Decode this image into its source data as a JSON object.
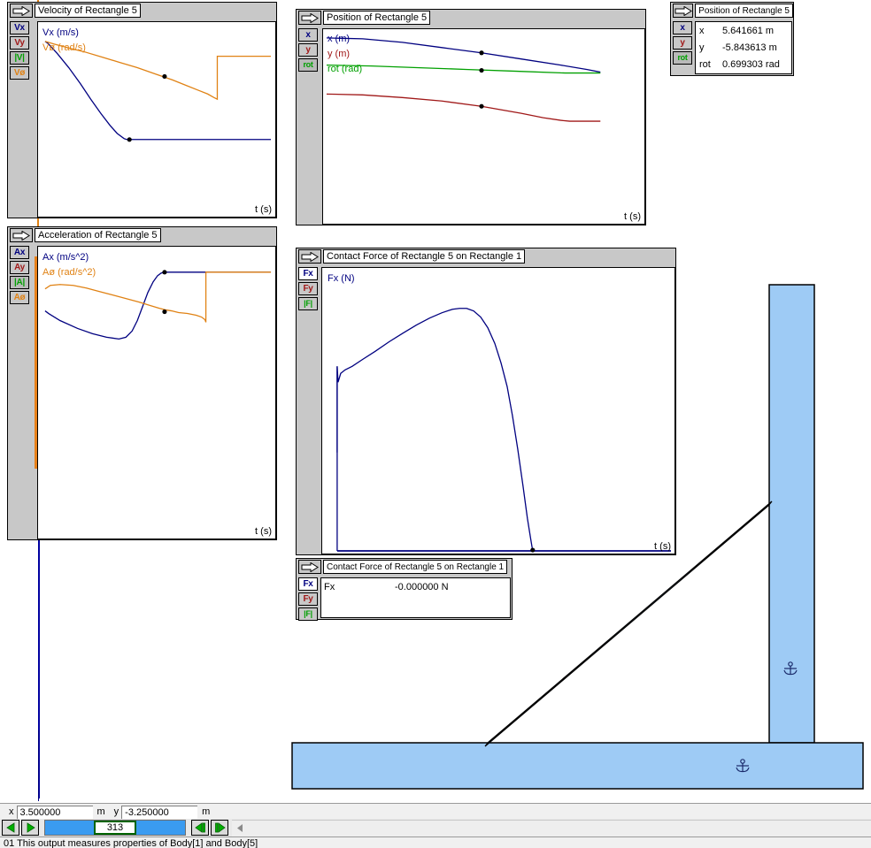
{
  "app": {
    "background": "#ffffff",
    "panel_bg": "#c8c8c8",
    "series_colors": {
      "blue": "#000080",
      "red": "#a01818",
      "green": "#00a000",
      "orange": "#e08214",
      "body_fill": "#9ecbf5",
      "body_stroke": "#000000",
      "accent_green": "#00b000"
    }
  },
  "panels": {
    "velocity": {
      "title": "Velocity of Rectangle 5",
      "arrow_icon": "arrow-right-icon",
      "buttons": [
        {
          "label": "Vx",
          "name": "vx",
          "color": "#000080",
          "active": false
        },
        {
          "label": "Vy",
          "name": "vy",
          "color": "#a01818",
          "active": false
        },
        {
          "label": "|V|",
          "name": "vmag",
          "color": "#00a000",
          "active": true
        },
        {
          "label": "Vø",
          "name": "vrot",
          "color": "#e08214",
          "active": false
        }
      ],
      "legend": [
        {
          "text": "Vx (m/s)",
          "color": "#000080"
        },
        {
          "text": "Vø (rad/s)",
          "color": "#e08214"
        }
      ],
      "xaxis_label": "t (s)"
    },
    "acceleration": {
      "title": "Acceleration of Rectangle 5",
      "arrow_icon": "arrow-right-icon",
      "buttons": [
        {
          "label": "Ax",
          "name": "ax",
          "color": "#000080",
          "active": false
        },
        {
          "label": "Ay",
          "name": "ay",
          "color": "#a01818",
          "active": false
        },
        {
          "label": "|A|",
          "name": "amag",
          "color": "#00a000",
          "active": true
        },
        {
          "label": "Aø",
          "name": "arot",
          "color": "#e08214",
          "active": false
        }
      ],
      "legend": [
        {
          "text": "Ax (m/s^2)",
          "color": "#000080"
        },
        {
          "text": "Aø (rad/s^2)",
          "color": "#e08214"
        }
      ],
      "xaxis_label": "t (s)"
    },
    "position_graph": {
      "title": "Position of Rectangle 5",
      "arrow_icon": "arrow-right-icon",
      "buttons": [
        {
          "label": "x",
          "name": "x",
          "color": "#000080",
          "active": false
        },
        {
          "label": "y",
          "name": "y",
          "color": "#a01818",
          "active": false
        },
        {
          "label": "rot",
          "name": "rot",
          "color": "#00a000",
          "active": true
        }
      ],
      "legend": [
        {
          "text": "x (m)",
          "color": "#000080"
        },
        {
          "text": "y (m)",
          "color": "#a01818"
        },
        {
          "text": "rot (rad)",
          "color": "#00a000"
        }
      ],
      "xaxis_label": "t (s)"
    },
    "position_values": {
      "title": "Position of Rectangle 5",
      "arrow_icon": "arrow-right-icon",
      "buttons": [
        {
          "label": "x",
          "name": "x",
          "color": "#000080",
          "active": false
        },
        {
          "label": "y",
          "name": "y",
          "color": "#a01818",
          "active": false
        },
        {
          "label": "rot",
          "name": "rot",
          "color": "#00a000",
          "active": true
        }
      ],
      "rows": [
        {
          "label": "x",
          "value": "5.641661 m"
        },
        {
          "label": "y",
          "value": "-5.843613 m"
        },
        {
          "label": "rot",
          "value": "0.699303 rad"
        }
      ]
    },
    "force_graph": {
      "title": "Contact Force of Rectangle 5 on Rectangle 1",
      "arrow_icon": "arrow-right-icon",
      "buttons": [
        {
          "label": "Fx",
          "name": "fx",
          "color": "#000080",
          "active": true
        },
        {
          "label": "Fy",
          "name": "fy",
          "color": "#a01818",
          "active": false
        },
        {
          "label": "|F|",
          "name": "fmag",
          "color": "#00a000",
          "active": false
        }
      ],
      "legend": [
        {
          "text": "Fx (N)",
          "color": "#000080"
        }
      ],
      "xaxis_label": "t (s)"
    },
    "force_values": {
      "title": "Contact Force of Rectangle 5 on Rectangle 1",
      "arrow_icon": "arrow-right-icon",
      "buttons": [
        {
          "label": "Fx",
          "name": "fx",
          "color": "#000080",
          "active": true
        },
        {
          "label": "Fy",
          "name": "fy",
          "color": "#a01818",
          "active": false
        },
        {
          "label": "|F|",
          "name": "fmag",
          "color": "#00a000",
          "active": false
        }
      ],
      "rows": [
        {
          "label": "Fx",
          "value": "-0.000000 N"
        }
      ]
    }
  },
  "scene": {
    "bodies": [
      {
        "name": "ground-rectangle",
        "shape": "rect",
        "anchored": true
      },
      {
        "name": "wall-rectangle",
        "shape": "rect",
        "anchored": true
      },
      {
        "name": "ladder-rod",
        "shape": "rod",
        "anchored": false
      }
    ],
    "anchor_icon": "anchor-icon"
  },
  "coordbar": {
    "x_label": "x",
    "x_value": "3.500000",
    "x_unit": "m",
    "y_label": "y",
    "y_value": "-3.250000",
    "y_unit": "m"
  },
  "controlbar": {
    "step_back_icon": "triangle-left-icon",
    "play_icon": "triangle-right-icon",
    "frame_value": "313",
    "prev_frame_icon": "step-back-icon",
    "next_frame_icon": "step-forward-icon",
    "scroll_left_icon": "scroll-left-arrow-icon"
  },
  "statusbar": {
    "text": "01  This output measures properties of Body[1] and Body[5]"
  },
  "chart_data": [
    {
      "type": "line",
      "name": "velocity",
      "title": "Velocity of Rectangle 5",
      "xlabel": "t (s)",
      "ylabel": "",
      "grid": false,
      "legend_position": "top-left",
      "series": [
        {
          "name": "Vx (m/s)",
          "color": "#000080",
          "points": [
            [
              0,
              100
            ],
            [
              3,
              99
            ],
            [
              12,
              93
            ],
            [
              22,
              85
            ],
            [
              33,
              76
            ],
            [
              44,
              66
            ],
            [
              55,
              57
            ],
            [
              64,
              50
            ],
            [
              72,
              45
            ],
            [
              80,
              42
            ],
            [
              84,
              41
            ],
            [
              88,
              41
            ],
            [
              120,
              41
            ],
            [
              160,
              41
            ],
            [
              200,
              41
            ],
            [
              240,
              41
            ],
            [
              262,
              41
            ]
          ]
        },
        {
          "name": "Vø (rad/s)",
          "color": "#e08214",
          "points": [
            [
              0,
              100
            ],
            [
              10,
              98
            ],
            [
              25,
              96
            ],
            [
              45,
              93
            ],
            [
              65,
              90
            ],
            [
              85,
              87
            ],
            [
              105,
              84
            ],
            [
              125,
              81
            ],
            [
              145,
              78
            ],
            [
              160,
              75
            ],
            [
              175,
              72
            ],
            [
              185,
              70
            ],
            [
              192,
              68
            ],
            [
              196,
              67
            ],
            [
              196,
              92
            ],
            [
              200,
              92
            ],
            [
              262,
              92
            ]
          ]
        }
      ],
      "markers": [
        {
          "x": 138,
          "y": 83,
          "color": "#000000"
        },
        {
          "x": 88,
          "y": 41,
          "color": "#000000"
        }
      ]
    },
    {
      "type": "line",
      "name": "acceleration",
      "title": "Acceleration of Rectangle 5",
      "xlabel": "t (s)",
      "ylabel": "",
      "grid": false,
      "legend_position": "top-left",
      "series": [
        {
          "name": "Ax (m/s^2)",
          "color": "#000080",
          "points": [
            [
              7,
              77
            ],
            [
              12,
              78
            ],
            [
              25,
              81
            ],
            [
              45,
              85
            ],
            [
              65,
              88
            ],
            [
              80,
              90
            ],
            [
              95,
              91
            ],
            [
              105,
              90
            ],
            [
              112,
              86
            ],
            [
              118,
              78
            ],
            [
              124,
              66
            ],
            [
              130,
              55
            ],
            [
              136,
              48
            ],
            [
              140,
              45
            ],
            [
              143,
              44
            ],
            [
              146,
              43
            ],
            [
              180,
              43
            ],
            [
              220,
              43
            ],
            [
              262,
              43
            ]
          ]
        },
        {
          "name": "Aø (rad/s^2)",
          "color": "#e08214",
          "points": [
            [
              7,
              58
            ],
            [
              14,
              56
            ],
            [
              25,
              55
            ],
            [
              40,
              56
            ],
            [
              55,
              58
            ],
            [
              70,
              60
            ],
            [
              85,
              62
            ],
            [
              100,
              64
            ],
            [
              115,
              66
            ],
            [
              128,
              68
            ],
            [
              138,
              69
            ],
            [
              146,
              69
            ],
            [
              152,
              68
            ],
            [
              160,
              67
            ],
            [
              170,
              67
            ],
            [
              180,
              68
            ],
            [
              186,
              70
            ],
            [
              190,
              72
            ],
            [
              192,
              74
            ],
            [
              192,
              43
            ],
            [
              210,
              43
            ],
            [
              240,
              43
            ],
            [
              262,
              43
            ]
          ]
        }
      ],
      "markers": [
        {
          "x": 143,
          "y": 44,
          "color": "#000000"
        },
        {
          "x": 143,
          "y": 69,
          "color": "#000000"
        }
      ]
    },
    {
      "type": "line",
      "name": "position",
      "title": "Position of Rectangle 5",
      "xlabel": "t (s)",
      "ylabel": "",
      "grid": false,
      "legend_position": "top-left",
      "series": [
        {
          "name": "x (m)",
          "color": "#000080",
          "points": [
            [
              0,
              9
            ],
            [
              40,
              10
            ],
            [
              80,
              13
            ],
            [
              120,
              17
            ],
            [
              160,
              21
            ],
            [
              200,
              25
            ],
            [
              240,
              29
            ],
            [
              280,
              33
            ],
            [
              310,
              35
            ]
          ]
        },
        {
          "name": "rot (rad)",
          "color": "#00a000",
          "points": [
            [
              0,
              38
            ],
            [
              50,
              39
            ],
            [
              100,
              40
            ],
            [
              150,
              41
            ],
            [
              200,
              42
            ],
            [
              250,
              43
            ],
            [
              310,
              43
            ]
          ]
        },
        {
          "name": "y (m)",
          "color": "#a01818",
          "points": [
            [
              0,
              67
            ],
            [
              40,
              68
            ],
            [
              80,
              70
            ],
            [
              120,
              73
            ],
            [
              160,
              77
            ],
            [
              200,
              82
            ],
            [
              230,
              86
            ],
            [
              250,
              88
            ],
            [
              260,
              89
            ],
            [
              310,
              89
            ]
          ]
        }
      ],
      "markers": [
        {
          "x": 160,
          "y": 21,
          "color": "#000000"
        },
        {
          "x": 160,
          "y": 42,
          "color": "#000000"
        },
        {
          "x": 160,
          "y": 77,
          "color": "#000000"
        }
      ]
    },
    {
      "type": "line",
      "name": "contact_force",
      "title": "Contact Force of Rectangle 5 on Rectangle 1",
      "xlabel": "t (s)",
      "ylabel": "",
      "grid": false,
      "legend_position": "top-left",
      "series": [
        {
          "name": "Fx (N)",
          "color": "#000080",
          "points": [
            [
              14,
              100
            ],
            [
              14,
              62
            ],
            [
              16,
              66
            ],
            [
              20,
              63
            ],
            [
              30,
              60
            ],
            [
              45,
              55
            ],
            [
              60,
              48
            ],
            [
              75,
              40
            ],
            [
              90,
              33
            ],
            [
              105,
              27
            ],
            [
              120,
              22
            ],
            [
              135,
              19
            ],
            [
              148,
              18
            ],
            [
              155,
              18
            ],
            [
              162,
              19
            ],
            [
              170,
              23
            ],
            [
              178,
              30
            ],
            [
              186,
              41
            ],
            [
              192,
              52
            ],
            [
              198,
              64
            ],
            [
              203,
              76
            ],
            [
              208,
              88
            ],
            [
              212,
              97
            ],
            [
              215,
              100
            ],
            [
              260,
              100
            ],
            [
              330,
              100
            ],
            [
              400,
              100
            ]
          ]
        }
      ],
      "markers": [
        {
          "x": 215,
          "y": 100,
          "color": "#000000"
        }
      ]
    }
  ]
}
